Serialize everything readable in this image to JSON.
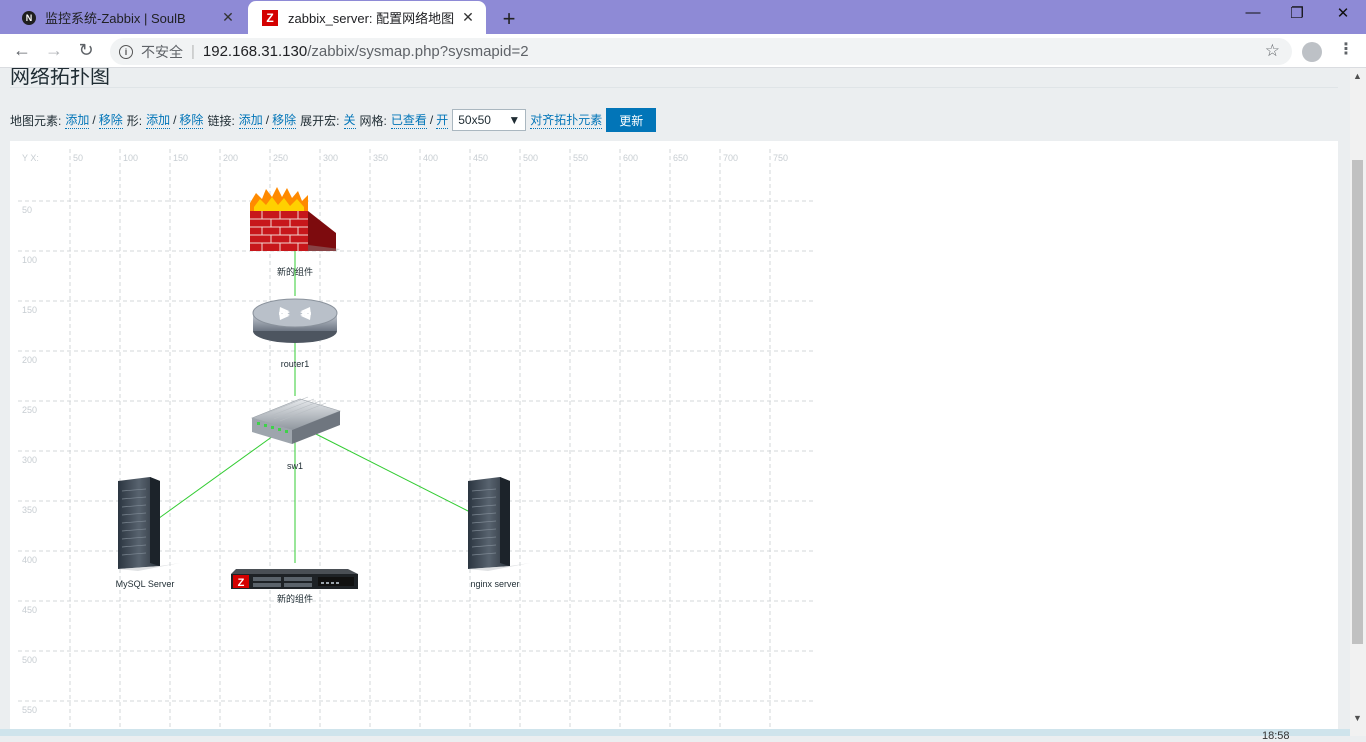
{
  "browser": {
    "tabs": [
      {
        "title": "监控系统-Zabbix | SoulB",
        "favicon": "N",
        "close": "✕"
      },
      {
        "title": "zabbix_server: 配置网络地图",
        "favicon": "Z",
        "close": "✕"
      }
    ],
    "new_tab": "+",
    "window_controls": {
      "minimize": "—",
      "restore": "❐",
      "close": "✕"
    },
    "nav": {
      "back": "←",
      "forward": "→",
      "reload": "↻"
    },
    "address": {
      "security_label": "不安全",
      "separator": "|",
      "host": "192.168.31.130",
      "path": "/zabbix/sysmap.php?sysmapid=2"
    },
    "star": "☆",
    "menu": "⋮"
  },
  "page": {
    "heading": "网络拓扑图",
    "controls": {
      "map_elements_label": "地图元素:",
      "shapes_label": "形:",
      "links_label": "链接:",
      "expand_macros_label": "展开宏:",
      "grid_label": "网格:",
      "add": "添加",
      "remove": "移除",
      "slash": "/",
      "expand_macros_value": "关",
      "grid_shown": "已查看",
      "grid_on": "开",
      "grid_size": "50x50",
      "align_elements": "对齐拓扑元素",
      "update_button": "更新"
    }
  },
  "map": {
    "axis_corner": "Y X:",
    "x_ticks": [
      "50",
      "100",
      "150",
      "200",
      "250",
      "300",
      "350",
      "400",
      "450",
      "500",
      "550",
      "600",
      "650",
      "700",
      "750"
    ],
    "y_ticks": [
      "50",
      "100",
      "150",
      "200",
      "250",
      "300",
      "350",
      "400",
      "450",
      "500",
      "550"
    ],
    "link_color": "#33cc33",
    "elements": [
      {
        "id": "firewall",
        "label": "新的组件",
        "icon": "firewall-icon"
      },
      {
        "id": "router",
        "label": "router1",
        "icon": "router-icon"
      },
      {
        "id": "switch",
        "label": "sw1",
        "icon": "switch-icon"
      },
      {
        "id": "mysql",
        "label": "MySQL Server",
        "icon": "server-icon"
      },
      {
        "id": "zabbix",
        "label": "新的组件",
        "icon": "zabbix-appliance-icon"
      },
      {
        "id": "nginx",
        "label": "nginx server",
        "icon": "server-icon"
      }
    ]
  },
  "taskbar": {
    "clock": "18:58"
  }
}
